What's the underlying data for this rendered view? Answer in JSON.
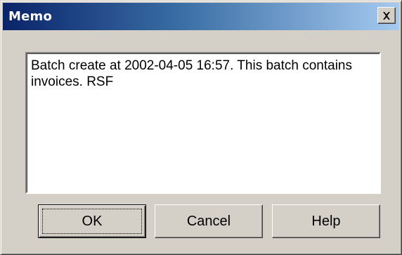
{
  "window": {
    "title": "Memo",
    "titlebar_gradient": [
      "#0a246a",
      "#a6caf0"
    ]
  },
  "memo": {
    "text": "Batch create at 2002-04-05 16:57. This batch contains invoices. RSF"
  },
  "buttons": {
    "ok_label": "OK",
    "cancel_label": "Cancel",
    "help_label": "Help"
  },
  "icons": {
    "close": "close-icon"
  }
}
